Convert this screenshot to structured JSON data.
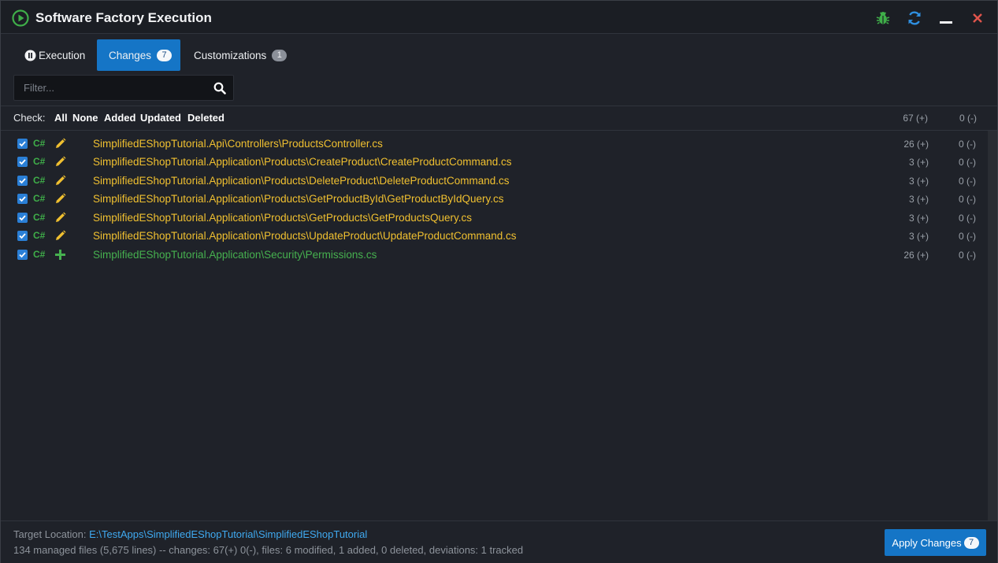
{
  "window": {
    "title": "Software Factory Execution",
    "accent": "#1575c6"
  },
  "titlebar_buttons": [
    "bug-icon",
    "refresh-icon",
    "minimize-icon",
    "close-icon"
  ],
  "tabs": [
    {
      "label": "Execution",
      "icon": "pause-circle-icon"
    },
    {
      "label": "Changes",
      "badge": "7",
      "active": true
    },
    {
      "label": "Customizations",
      "badge": "1"
    }
  ],
  "filter": {
    "placeholder": "Filter...",
    "value": ""
  },
  "check": {
    "label": "Check:",
    "options": [
      "All",
      "None",
      "Added",
      "Updated",
      "Deleted"
    ],
    "total_plus": "67 (+)",
    "total_minus": "0 (-)"
  },
  "files": [
    {
      "lang": "C#",
      "action": "modified",
      "path": "SimplifiedEShopTutorial.Api\\Controllers\\ProductsController.cs",
      "plus": "26 (+)",
      "minus": "0 (-)",
      "checked": true
    },
    {
      "lang": "C#",
      "action": "modified",
      "path": "SimplifiedEShopTutorial.Application\\Products\\CreateProduct\\CreateProductCommand.cs",
      "plus": "3 (+)",
      "minus": "0 (-)",
      "checked": true
    },
    {
      "lang": "C#",
      "action": "modified",
      "path": "SimplifiedEShopTutorial.Application\\Products\\DeleteProduct\\DeleteProductCommand.cs",
      "plus": "3 (+)",
      "minus": "0 (-)",
      "checked": true
    },
    {
      "lang": "C#",
      "action": "modified",
      "path": "SimplifiedEShopTutorial.Application\\Products\\GetProductById\\GetProductByIdQuery.cs",
      "plus": "3 (+)",
      "minus": "0 (-)",
      "checked": true
    },
    {
      "lang": "C#",
      "action": "modified",
      "path": "SimplifiedEShopTutorial.Application\\Products\\GetProducts\\GetProductsQuery.cs",
      "plus": "3 (+)",
      "minus": "0 (-)",
      "checked": true
    },
    {
      "lang": "C#",
      "action": "modified",
      "path": "SimplifiedEShopTutorial.Application\\Products\\UpdateProduct\\UpdateProductCommand.cs",
      "plus": "3 (+)",
      "minus": "0 (-)",
      "checked": true
    },
    {
      "lang": "C#",
      "action": "added",
      "path": "SimplifiedEShopTutorial.Application\\Security\\Permissions.cs",
      "plus": "26 (+)",
      "minus": "0 (-)",
      "checked": true
    }
  ],
  "footer": {
    "target_label": "Target Location:",
    "target_path": "E:\\TestApps\\SimplifiedEShopTutorial\\SimplifiedEShopTutorial",
    "summary": "134 managed files (5,675 lines) -- changes: 67(+) 0(-), files: 6 modified, 1 added, 0 deleted, deviations: 1 tracked",
    "apply_label": "Apply Changes",
    "apply_badge": "7"
  },
  "colors": {
    "modified": "#f0c030",
    "added": "#46b14f",
    "link": "#3fa9f0"
  }
}
